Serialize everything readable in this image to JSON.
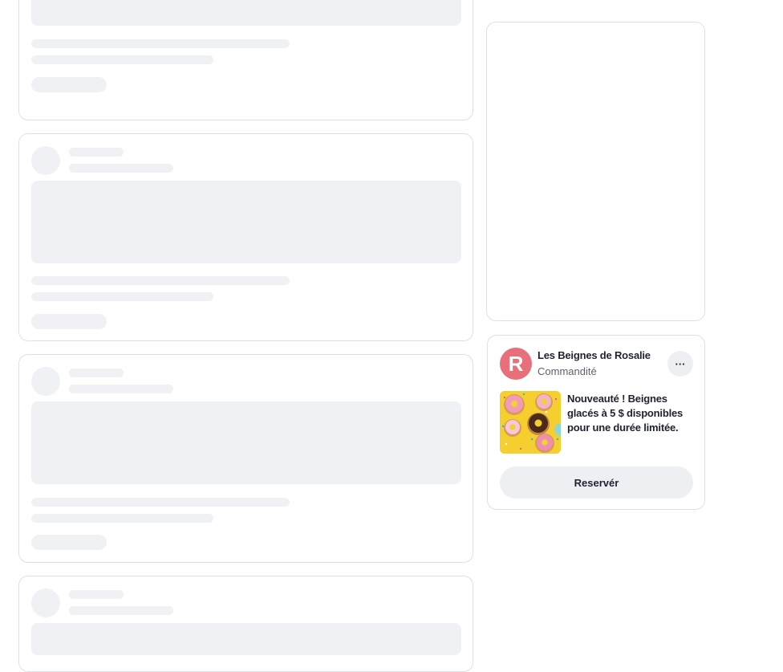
{
  "ad": {
    "brand_initial": "R",
    "brand_name": "Les Beignes de Rosalie",
    "label": "Commandité",
    "menu_icon": "more-horizontal-icon",
    "menu_glyph": "···",
    "headline": "Nouveauté ! Beignes glacés à 5 $ disponibles pour une durée limitée.",
    "image": "donuts-image",
    "cta_label": "Reservér",
    "brand_color": "#e7707a"
  },
  "colors": {
    "skeleton": "#f0f1f4",
    "border": "#dfe0e4",
    "thumbnail_bg": "#f5cf2e"
  }
}
